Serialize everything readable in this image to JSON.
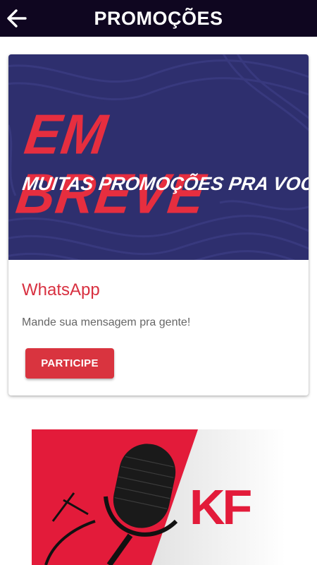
{
  "header": {
    "title": "PROMOÇÕES",
    "back_icon": "arrow-left-icon"
  },
  "promo_card": {
    "banner": {
      "headline": "EM BREVE",
      "subheadline": "MUITAS PROMOÇÕES PRA VOCÊ",
      "background_color": "#2e2f6e",
      "headline_color": "#e62e3f"
    },
    "title": "WhatsApp",
    "description": "Mande sua mensagem pra gente!",
    "button_label": "PARTICIPE",
    "accent_color": "#d9343f"
  },
  "second_promo": {
    "logo_text": "KF",
    "microphone_icon": "microphone-icon",
    "brand_color": "#e31b3a"
  }
}
